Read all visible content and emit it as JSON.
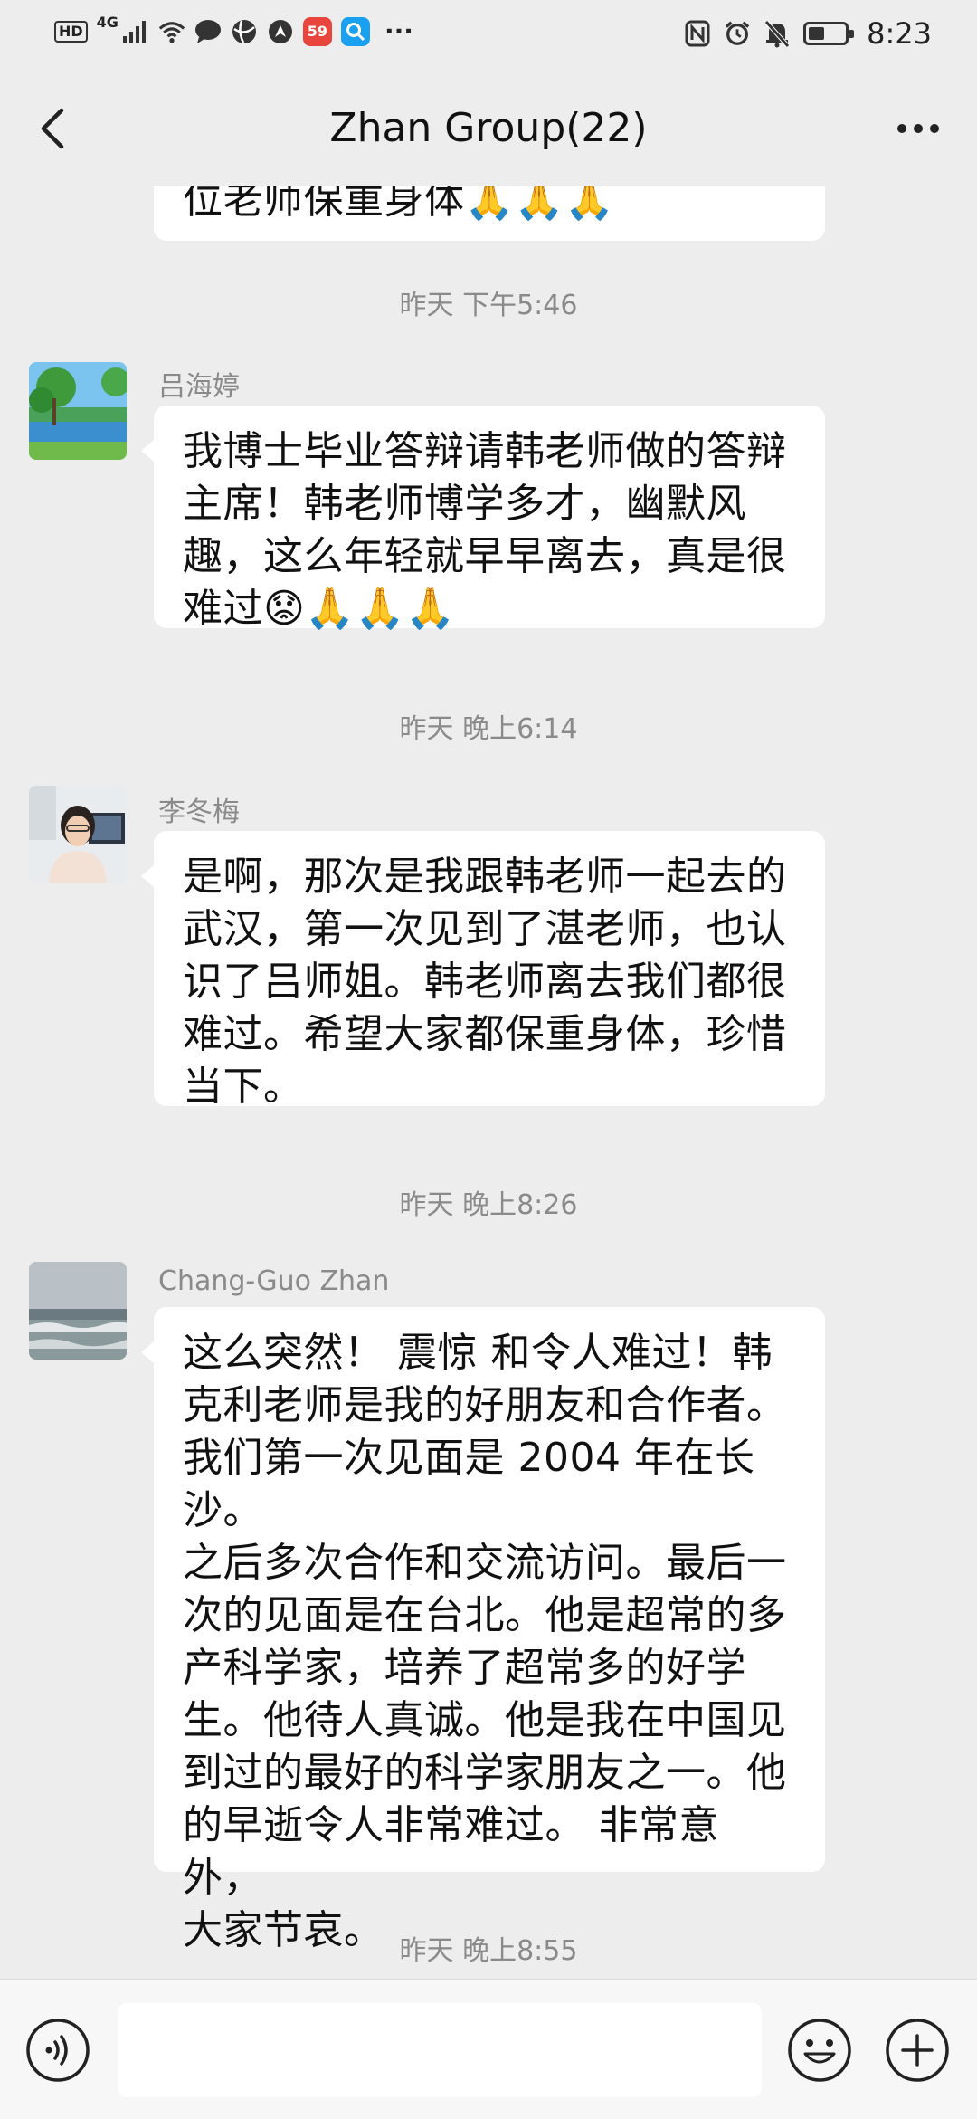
{
  "status_bar": {
    "hd": "HD",
    "network": "4G",
    "app_badge_text": "59",
    "overflow": "···",
    "time": "8:23",
    "icons": [
      "signal-icon",
      "wifi-icon",
      "chat-bubble-icon",
      "browser-icon",
      "location-icon",
      "app-icon",
      "search-app-icon",
      "nfc-icon",
      "alarm-icon",
      "mute-icon",
      "battery-icon"
    ],
    "battery_level": 0.45
  },
  "header": {
    "title": "Zhan Group(22)",
    "back_icon": "chevron-left-icon",
    "more_icon": "more-dots-icon"
  },
  "messages": [
    {
      "type": "partial",
      "text": "位老师保重身体🙏🙏🙏"
    },
    {
      "type": "timestamp",
      "text": "昨天 下午5:46"
    },
    {
      "type": "message",
      "sender": "吕海婷",
      "lines": [
        "我博士毕业答辩请韩老师做的答辩",
        "主席！韩老师博学多才，幽默风",
        "趣，这么年轻就早早离去，真是很",
        "难过😟🙏🙏🙏"
      ]
    },
    {
      "type": "timestamp",
      "text": "昨天 晚上6:14"
    },
    {
      "type": "message",
      "sender": "李冬梅",
      "lines": [
        "是啊，那次是我跟韩老师一起去的",
        "武汉，第一次见到了湛老师，也认",
        "识了吕师姐。韩老师离去我们都很",
        "难过。希望大家都保重身体，珍惜",
        "当下。"
      ]
    },
    {
      "type": "timestamp",
      "text": "昨天 晚上8:26"
    },
    {
      "type": "message",
      "sender": "Chang-Guo Zhan",
      "lines": [
        "这么突然！ 震惊 和令人难过！韩",
        "克利老师是我的好朋友和合作者。",
        "我们第一次见面是 2004 年在长沙。",
        "之后多次合作和交流访问。最后一",
        "次的见面是在台北。他是超常的多",
        "产科学家，培养了超常多的好学",
        "生。他待人真诚。他是我在中国见",
        "到过的最好的科学家朋友之一。他",
        "的早逝令人非常难过。 非常意外，",
        "大家节哀。"
      ]
    },
    {
      "type": "timestamp",
      "text": "昨天 晚上8:55"
    }
  ],
  "input_bar": {
    "voice_icon": "voice-icon",
    "emoji_icon": "emoji-icon",
    "plus_icon": "plus-icon",
    "value": ""
  }
}
